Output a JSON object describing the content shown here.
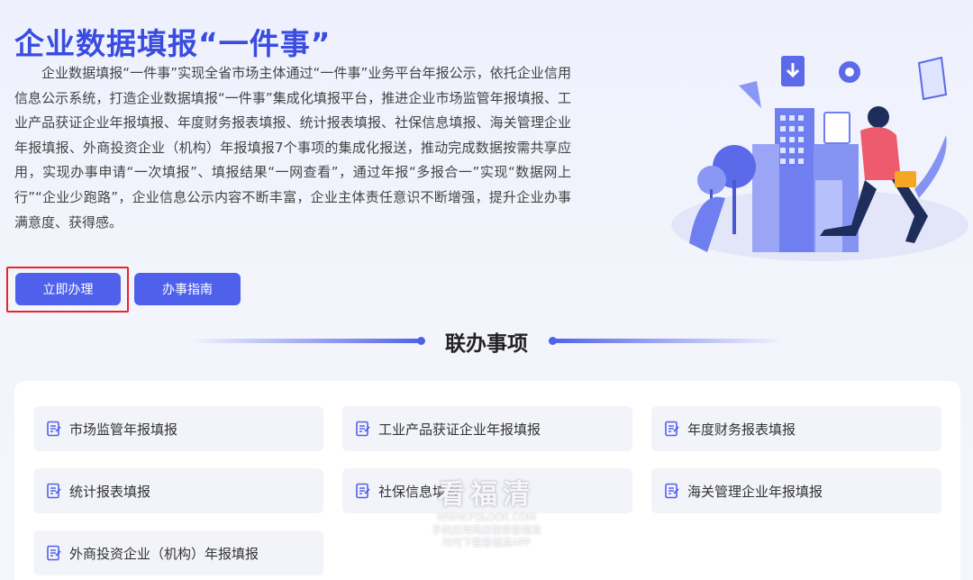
{
  "header": {
    "title": "企业数据填报“一件事”",
    "description": "企业数据填报“一件事”实现全省市场主体通过“一件事”业务平台年报公示，依托企业信用信息公示系统，打造企业数据填报“一件事”集成化填报平台，推进企业市场监管年报填报、工业产品获证企业年报填报、年度财务报表填报、统计报表填报、社保信息填报、海关管理企业年报填报、外商投资企业（机构）年报填报7个事项的集成化报送，推动完成数据按需共享应用，实现办事申请“一次填报”、填报结果“一网查看”，通过年报“多报合一”实现“数据网上行”“企业少跑路”，企业信息公示内容不断丰富，企业主体责任意识不断增强，提升企业办事满意度、获得感。"
  },
  "actions": {
    "apply_label": "立即办理",
    "guide_label": "办事指南"
  },
  "section": {
    "title": "联办事项"
  },
  "items": [
    {
      "label": "市场监管年报填报",
      "icon": "form-icon"
    },
    {
      "label": "工业产品获证企业年报填报",
      "icon": "form-icon"
    },
    {
      "label": "年度财务报表填报",
      "icon": "form-icon"
    },
    {
      "label": "统计报表填报",
      "icon": "form-icon"
    },
    {
      "label": "社保信息填报",
      "icon": "form-icon"
    },
    {
      "label": "海关管理企业年报填报",
      "icon": "form-icon"
    },
    {
      "label": "外商投资企业（机构）年报填报",
      "icon": "form-icon"
    }
  ],
  "watermark": {
    "brand": "看福清",
    "site": "WWW.FQLOOK.COM",
    "line1": "手机应用商店搜索看福清",
    "line2": "均可下载看福清APP"
  },
  "colors": {
    "accent": "#4f61eb",
    "title": "#3a4ce0",
    "highlight": "#e6262b"
  }
}
